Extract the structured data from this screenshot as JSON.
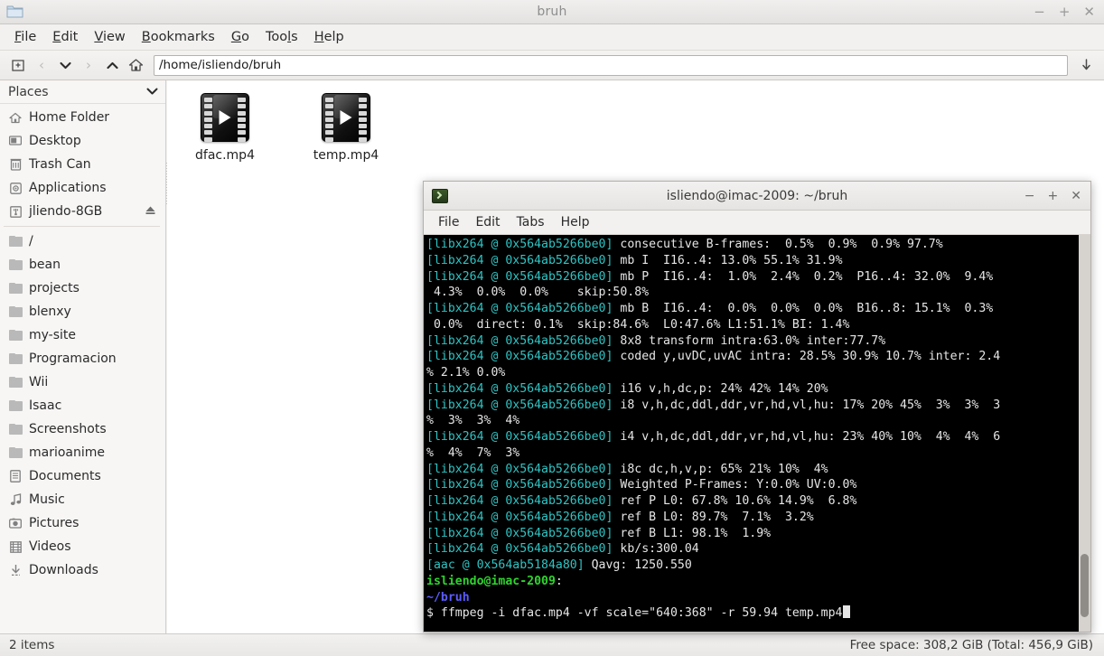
{
  "file_manager": {
    "title": "bruh",
    "app_icon": "folder-icon",
    "window_buttons": {
      "minimize": "−",
      "maximize": "+",
      "close": "✕"
    },
    "menus": [
      {
        "label": "File",
        "mnemonic": "F"
      },
      {
        "label": "Edit",
        "mnemonic": "E"
      },
      {
        "label": "View",
        "mnemonic": "V"
      },
      {
        "label": "Bookmarks",
        "mnemonic": "B"
      },
      {
        "label": "Go",
        "mnemonic": "G"
      },
      {
        "label": "Tools",
        "mnemonic": "T"
      },
      {
        "label": "Help",
        "mnemonic": "H"
      }
    ],
    "toolbar": {
      "new_tab_icon": "new-tab-icon",
      "back_icon": "chevron-left-icon",
      "history_icon": "chevron-down-icon",
      "forward_icon": "chevron-right-icon",
      "up_icon": "chevron-up-icon",
      "home_icon": "home-icon",
      "go_icon": "go-arrow-icon",
      "path_value": "/home/isliendo/bruh"
    },
    "sidebar": {
      "header": "Places",
      "collapse_icon": "chevron-down-icon",
      "items": [
        {
          "label": "Home Folder",
          "icon": "home-icon",
          "eject": false
        },
        {
          "label": "Desktop",
          "icon": "desktop-icon",
          "eject": false
        },
        {
          "label": "Trash Can",
          "icon": "trash-icon",
          "eject": false
        },
        {
          "label": "Applications",
          "icon": "applications-icon",
          "eject": false
        },
        {
          "label": "jliendo-8GB",
          "icon": "usb-drive-icon",
          "eject": true
        }
      ],
      "bookmarks": [
        {
          "label": "/",
          "icon": "folder-icon"
        },
        {
          "label": "bean",
          "icon": "folder-icon"
        },
        {
          "label": "projects",
          "icon": "folder-icon"
        },
        {
          "label": "blenxy",
          "icon": "folder-icon"
        },
        {
          "label": "my-site",
          "icon": "folder-icon"
        },
        {
          "label": "Programacion",
          "icon": "folder-icon"
        },
        {
          "label": "Wii",
          "icon": "folder-icon"
        },
        {
          "label": "Isaac",
          "icon": "folder-icon"
        },
        {
          "label": "Screenshots",
          "icon": "folder-icon"
        },
        {
          "label": "marioanime",
          "icon": "folder-icon"
        },
        {
          "label": "Documents",
          "icon": "documents-icon"
        },
        {
          "label": "Music",
          "icon": "music-icon"
        },
        {
          "label": "Pictures",
          "icon": "pictures-icon"
        },
        {
          "label": "Videos",
          "icon": "videos-icon"
        },
        {
          "label": "Downloads",
          "icon": "downloads-icon"
        }
      ]
    },
    "files": [
      {
        "name": "dfac.mp4",
        "icon": "video-file-icon"
      },
      {
        "name": "temp.mp4",
        "icon": "video-file-icon"
      }
    ],
    "statusbar": {
      "item_count": "2 items",
      "free_space": "Free space: 308,2 GiB (Total: 456,9 GiB)"
    }
  },
  "terminal": {
    "title": "isliendo@imac-2009: ~/bruh",
    "icon": "terminal-icon",
    "window_buttons": {
      "minimize": "−",
      "maximize": "+",
      "close": "✕"
    },
    "menus": [
      {
        "label": "File"
      },
      {
        "label": "Edit"
      },
      {
        "label": "Tabs"
      },
      {
        "label": "Help"
      }
    ],
    "prefix_libx264": "[libx264 @ 0x564ab5266be0]",
    "prefix_aac": "[aac @ 0x564ab5184a80]",
    "lines": [
      {
        "prefix": "libx264",
        "text": " consecutive B-frames:  0.5%  0.9%  0.9% 97.7%"
      },
      {
        "prefix": "libx264",
        "text": " mb I  I16..4: 13.0% 55.1% 31.9%"
      },
      {
        "prefix": "libx264",
        "text": " mb P  I16..4:  1.0%  2.4%  0.2%  P16..4: 32.0%  9.4%"
      },
      {
        "prefix": "none",
        "text": " 4.3%  0.0%  0.0%    skip:50.8%"
      },
      {
        "prefix": "libx264",
        "text": " mb B  I16..4:  0.0%  0.0%  0.0%  B16..8: 15.1%  0.3%"
      },
      {
        "prefix": "none",
        "text": " 0.0%  direct: 0.1%  skip:84.6%  L0:47.6% L1:51.1% BI: 1.4%"
      },
      {
        "prefix": "libx264",
        "text": " 8x8 transform intra:63.0% inter:77.7%"
      },
      {
        "prefix": "libx264",
        "text": " coded y,uvDC,uvAC intra: 28.5% 30.9% 10.7% inter: 2.4"
      },
      {
        "prefix": "none",
        "text": "% 2.1% 0.0%"
      },
      {
        "prefix": "libx264",
        "text": " i16 v,h,dc,p: 24% 42% 14% 20%"
      },
      {
        "prefix": "libx264",
        "text": " i8 v,h,dc,ddl,ddr,vr,hd,vl,hu: 17% 20% 45%  3%  3%  3"
      },
      {
        "prefix": "none",
        "text": "%  3%  3%  4%"
      },
      {
        "prefix": "libx264",
        "text": " i4 v,h,dc,ddl,ddr,vr,hd,vl,hu: 23% 40% 10%  4%  4%  6"
      },
      {
        "prefix": "none",
        "text": "%  4%  7%  3%"
      },
      {
        "prefix": "libx264",
        "text": " i8c dc,h,v,p: 65% 21% 10%  4%"
      },
      {
        "prefix": "libx264",
        "text": " Weighted P-Frames: Y:0.0% UV:0.0%"
      },
      {
        "prefix": "libx264",
        "text": " ref P L0: 67.8% 10.6% 14.9%  6.8%"
      },
      {
        "prefix": "libx264",
        "text": " ref B L0: 89.7%  7.1%  3.2%"
      },
      {
        "prefix": "libx264",
        "text": " ref B L1: 98.1%  1.9%"
      },
      {
        "prefix": "libx264",
        "text": " kb/s:300.04"
      },
      {
        "prefix": "aac",
        "text": " Qavg: 1250.550"
      }
    ],
    "prompt_user_host": "isliendo@imac-2009",
    "prompt_colon": ":",
    "prompt_path": "~/bruh",
    "prompt_symbol": "$",
    "command": " ffmpeg -i dfac.mp4 -vf scale=\"640:368\" -r 59.94 temp.mp4",
    "colors": {
      "prefix": "#2fc4c4",
      "user_host": "#2fd42f",
      "path": "#5c5cff",
      "text": "#d8d8d8",
      "background": "#000000"
    }
  }
}
